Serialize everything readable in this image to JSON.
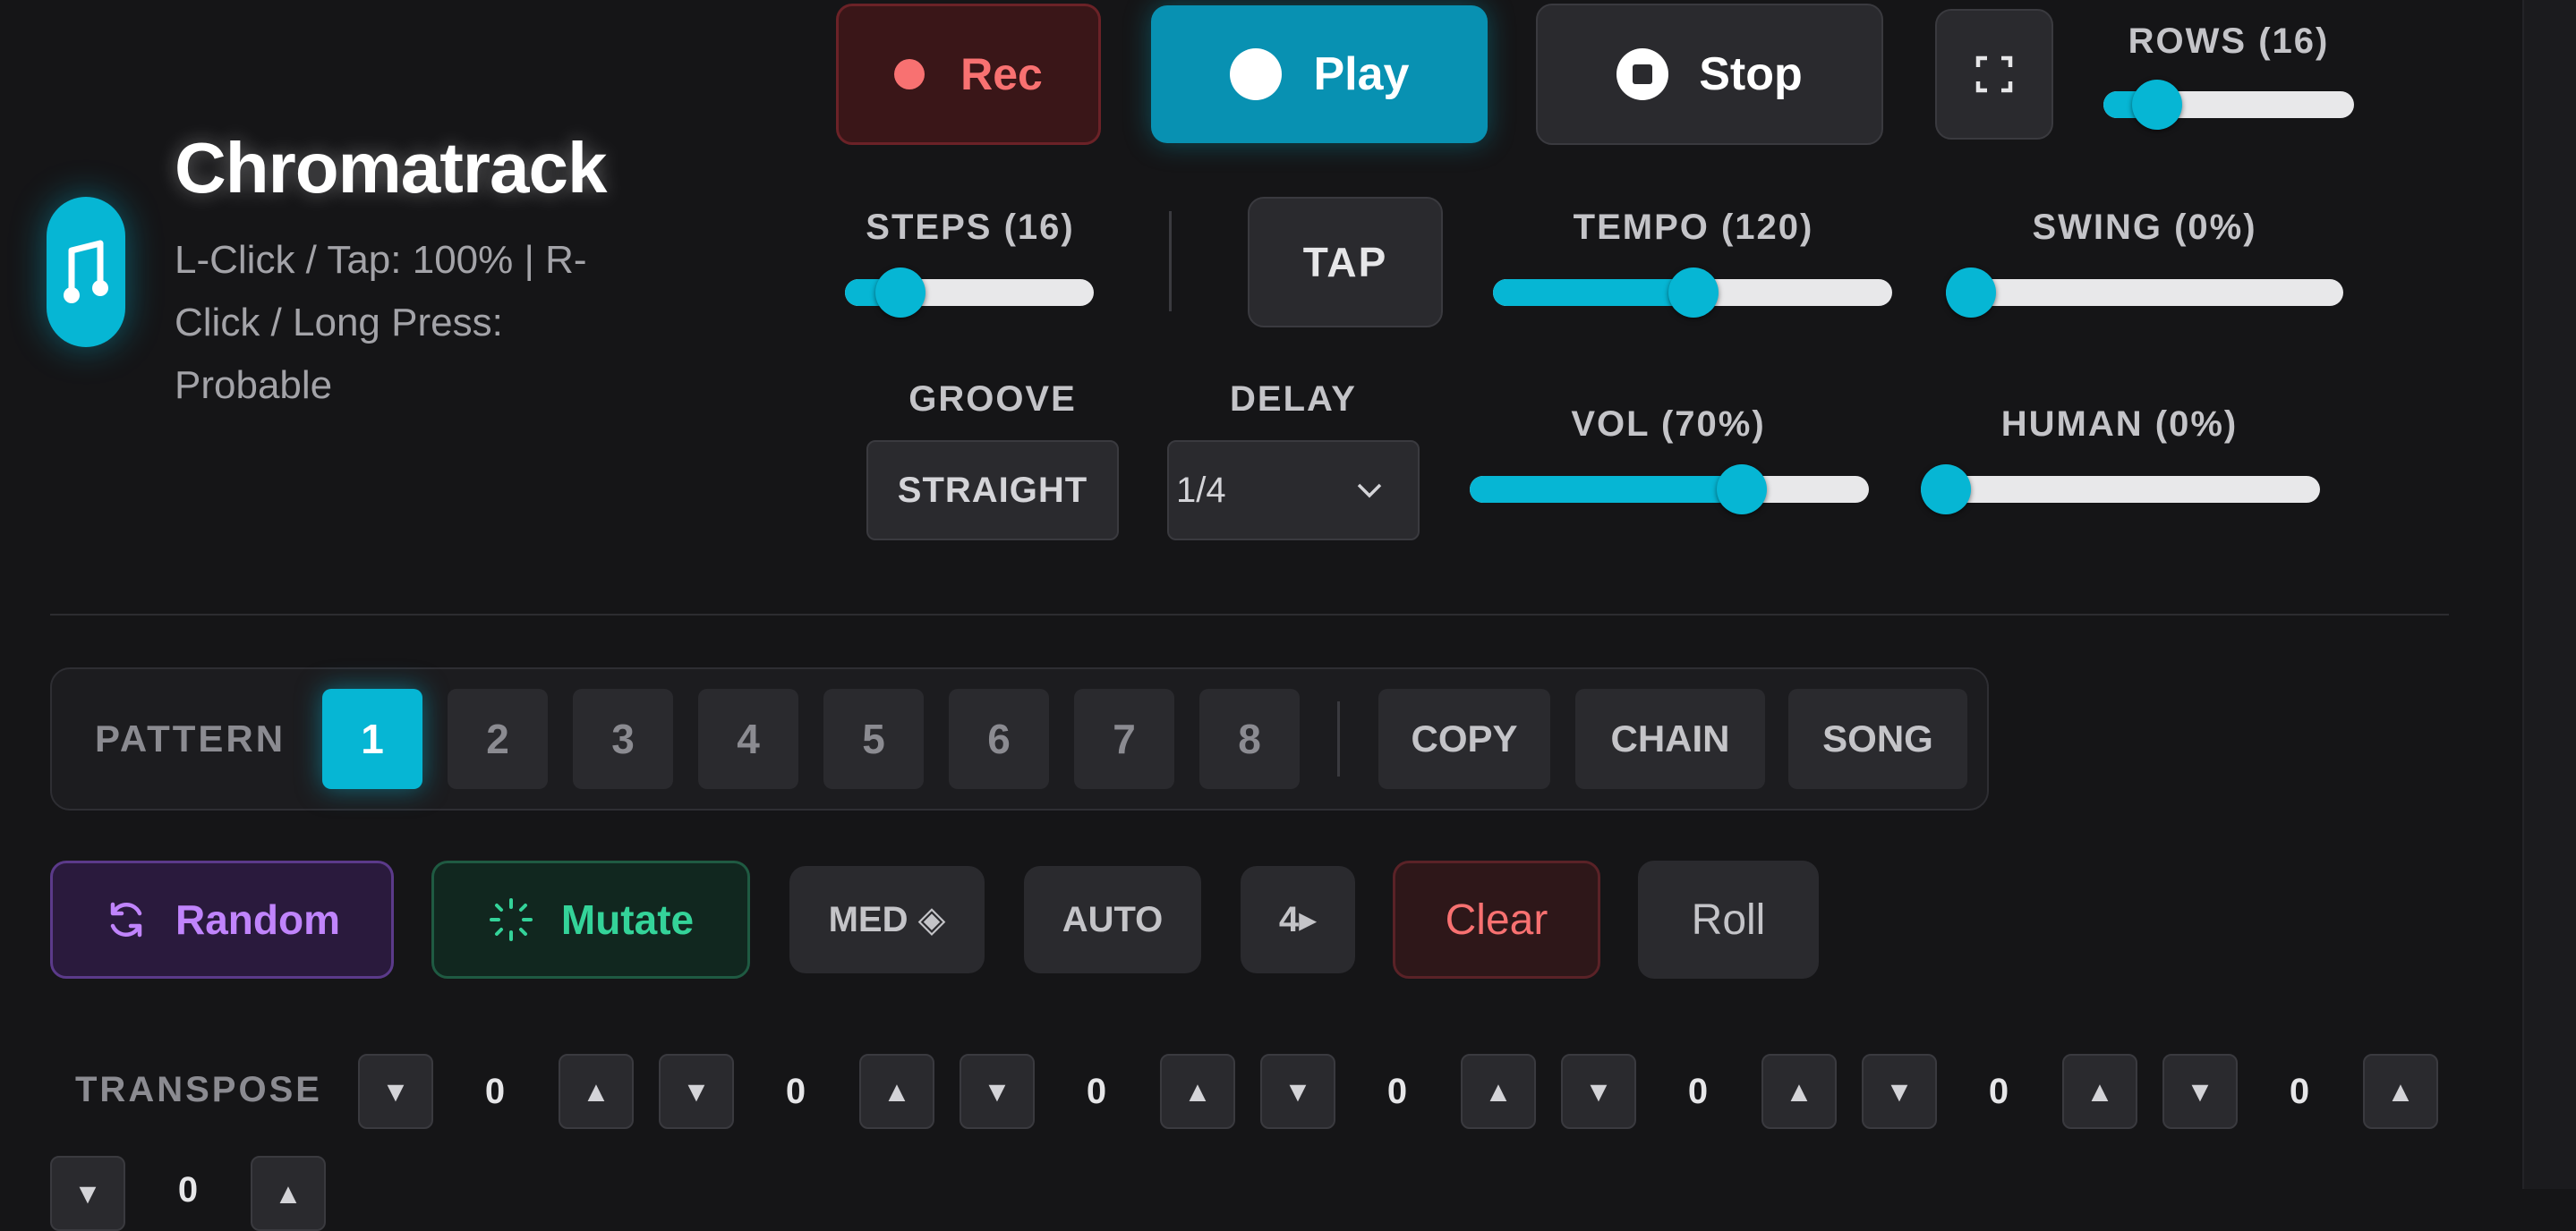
{
  "app": {
    "title": "Chromatrack",
    "subtitle": "L-Click / Tap: 100% | R-Click / Long Press: Probable"
  },
  "transport": {
    "rec": "Rec",
    "play": "Play",
    "stop": "Stop"
  },
  "controls": {
    "rows_label": "ROWS (16)",
    "rows_value_fraction": 0.18,
    "steps_label": "STEPS (16)",
    "steps_value_fraction": 0.18,
    "tap_label": "TAP",
    "tempo_label": "TEMPO (120)",
    "tempo_value_fraction": 0.51,
    "swing_label": "SWING (0%)",
    "swing_value": 0,
    "groove_label": "GROOVE",
    "groove_value": "STRAIGHT",
    "delay_label": "DELAY",
    "delay_value": "1/4",
    "vol_label": "VOL (70%)",
    "vol_value": 70,
    "human_label": "HUMAN (0%)",
    "human_value": 0
  },
  "pattern": {
    "label": "PATTERN",
    "items": [
      "1",
      "2",
      "3",
      "4",
      "5",
      "6",
      "7",
      "8"
    ],
    "active": "1",
    "copy": "COPY",
    "chain": "CHAIN",
    "song": "SONG"
  },
  "actions": {
    "random": "Random",
    "mutate": "Mutate",
    "med": "MED ◈",
    "auto": "AUTO",
    "four": "4▸",
    "clear": "Clear",
    "roll": "Roll"
  },
  "transpose": {
    "label": "TRANSPOSE",
    "values": [
      "0",
      "0",
      "0",
      "0",
      "0",
      "0",
      "0",
      "0"
    ],
    "down": "▼",
    "up": "▲"
  },
  "colors": {
    "accent": "#06b6d4",
    "rec": "#f87171",
    "random": "#c084fc",
    "mutate": "#34d399"
  }
}
